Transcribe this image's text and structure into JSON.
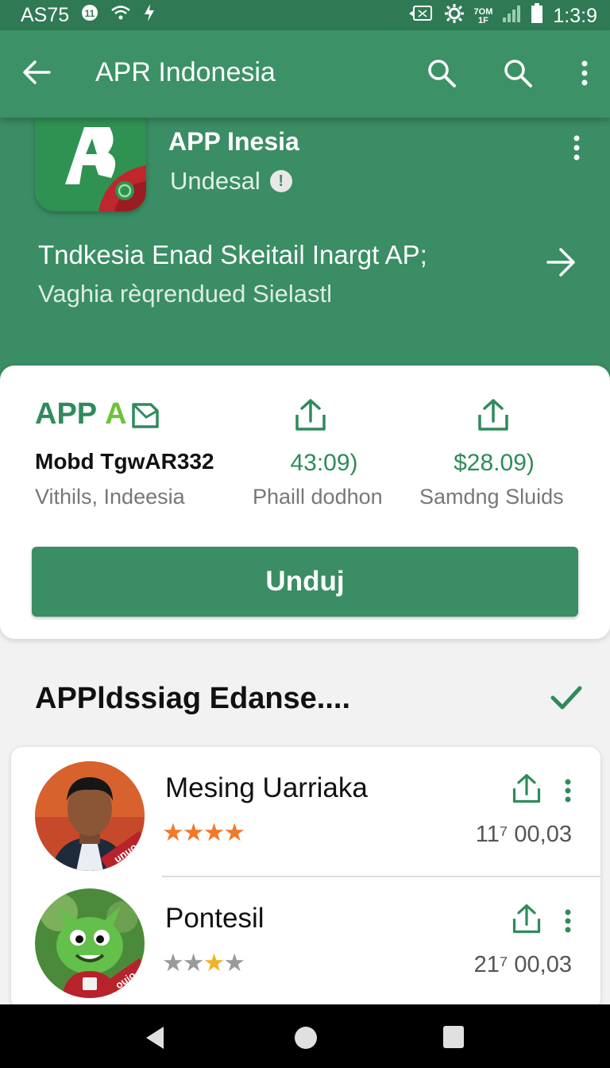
{
  "status_bar": {
    "carrier": "AS75",
    "network_top": "7OM",
    "network_bottom": "1F",
    "time": "1:3:9"
  },
  "app_bar": {
    "title": "APR Indonesia"
  },
  "app": {
    "name": "APP Inesia",
    "developer": "Undesal",
    "info_glyph": "!",
    "tagline": "Tndkesia  Enad Skeitail  Inargt AP;",
    "subline": "Vaghia rèqrendued Sielastl"
  },
  "info_card": {
    "brand_text": "APP",
    "brand_letter": "A",
    "stat1_title": "Mobd TgwAR332",
    "stat1_sub": "Vithils, Indeesia",
    "stat2_value": "43:09)",
    "stat2_sub": "Phaill dodhon",
    "stat3_value": "$28.09)",
    "stat3_sub": "Samdng Sluids",
    "install_label": "Unduj"
  },
  "section": {
    "title": "APPldssiag Edanse...."
  },
  "list": [
    {
      "name": "Mesing Uarriaka",
      "stars": "★★★★",
      "rating": 4,
      "meta": "11⁷  00,03",
      "badge": "unuo"
    },
    {
      "name": "Pontesil",
      "stars": "★★★★",
      "rating": 2.5,
      "meta": "21⁷  00,03",
      "badge": "ouio"
    }
  ],
  "colors": {
    "accent": "#3a8d64",
    "star_active": "#f07a2a",
    "star_inactive": "#9a9a9a"
  }
}
